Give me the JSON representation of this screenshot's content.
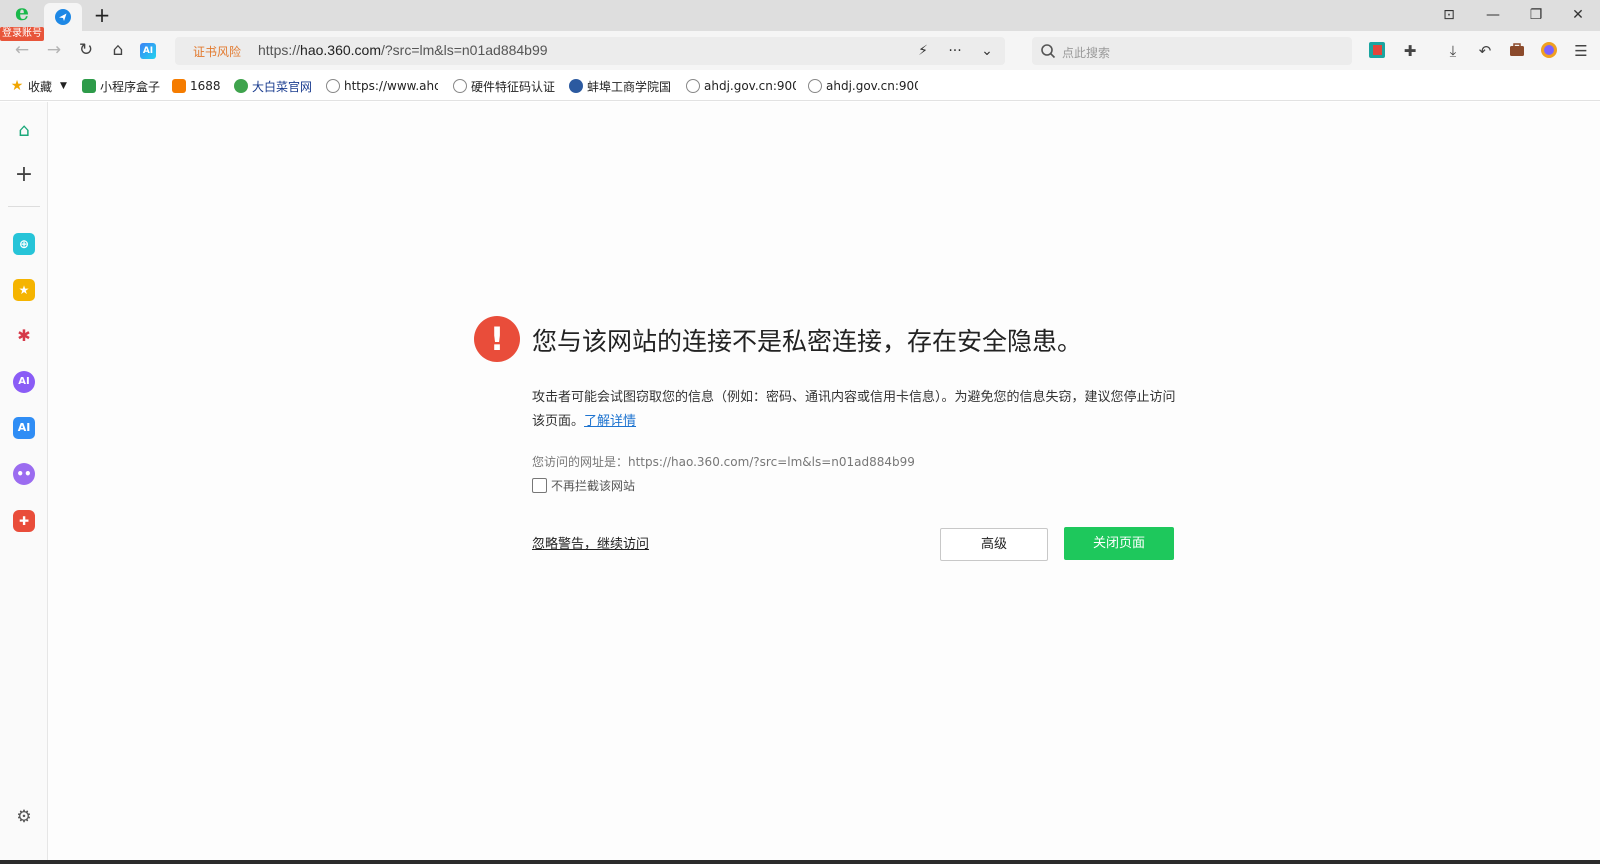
{
  "browser": {
    "login_badge": "登录账号",
    "new_tab_symbol": "+",
    "window_controls": [
      "⊡",
      "—",
      "❐",
      "✕"
    ]
  },
  "navbar": {
    "cert_warning": "证书风险",
    "url_prefix": "https://",
    "url_host": "hao.360.com",
    "url_path": "/?src=lm&ls=n01ad884b99",
    "search_placeholder": "点此搜索",
    "ai_label": "AI"
  },
  "bookmarks": [
    {
      "label": "收藏",
      "icon": "star-icon"
    },
    {
      "label": "小程序盒子",
      "icon": "mini-program-icon"
    },
    {
      "label": "1688",
      "icon": "1688-icon"
    },
    {
      "label": "大白菜官网",
      "icon": "cabbage-icon"
    },
    {
      "label": "https://www.ahd",
      "icon": "globe-icon"
    },
    {
      "label": "硬件特征码认证",
      "icon": "globe-icon"
    },
    {
      "label": "蚌埠工商学院国",
      "icon": "college-icon"
    },
    {
      "label": "ahdj.gov.cn:900",
      "icon": "globe-icon"
    },
    {
      "label": "ahdj.gov.cn:900",
      "icon": "globe-icon"
    }
  ],
  "warning": {
    "title": "您与该网站的连接不是私密连接，存在安全隐患。",
    "description": "攻击者可能会试图窃取您的信息（例如：密码、通讯内容或信用卡信息）。为避免您的信息失窃，建议您停止访问该页面。",
    "learn_more": "了解详情",
    "visited_url_label": "您访问的网址是：https://hao.360.com/?src=lm&ls=n01ad884b99",
    "no_block_label": "不再拦截该网站",
    "ignore_link": "忽略警告，继续访问",
    "advanced_button": "高级",
    "close_button": "关闭页面"
  },
  "colors": {
    "accent_green": "#1ec85c",
    "warning_red": "#e94d3a",
    "link_blue": "#1e74d0",
    "cert_orange": "#e27a2f"
  }
}
